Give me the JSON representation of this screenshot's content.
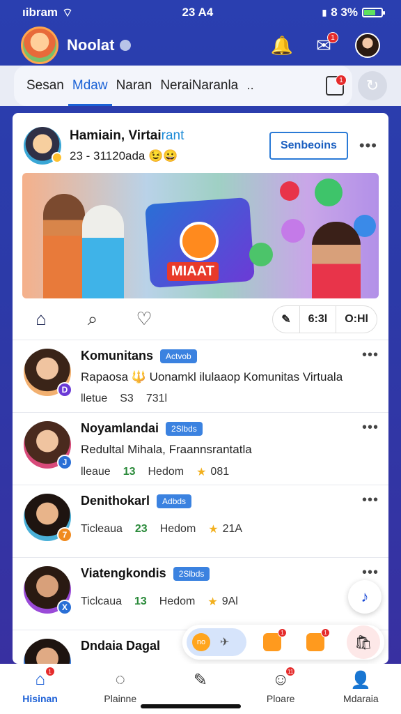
{
  "status_bar": {
    "carrier": "ıibram",
    "time": "23 A4",
    "battery_text": "8 3%",
    "battery_level": 0.6
  },
  "header": {
    "title": "Noolat"
  },
  "tabs": {
    "items": [
      "Sesan",
      "Mdaw",
      "Naran",
      "NeraiNaranla"
    ],
    "active": "Mdaw",
    "more": "..",
    "notif_count": "1"
  },
  "post": {
    "name_bold": "Hamiain, Virtai",
    "name_highlight": "rant",
    "subtitle": "23 - 31120ada 😉😀",
    "subscribe_label": "Senbeoins",
    "banner_text": "MIAAT",
    "pill_left": "6:3l",
    "pill_right": "O:Hl"
  },
  "list": [
    {
      "name": "Komunitans",
      "tag": "Actvob",
      "desc": "Rapaosa 🔱 Uonamkl ilulaaop Komunitas Virtuala",
      "stat1": "lletue",
      "stat2": "S3",
      "stat3": "731l",
      "badge": "D",
      "badge_color": "#6b3ad6"
    },
    {
      "name": "Noyamlandai",
      "tag": "2Slbds",
      "desc": "Redultal Mihala, Fraannsrantatla",
      "stat1": "lleaue",
      "stat2": "13",
      "stat3": "Hedom",
      "stat4": "081",
      "badge": "J",
      "badge_color": "#2a6fd6"
    },
    {
      "name": "Denithokarl",
      "tag": "Adbds",
      "desc": "",
      "stat1": "Ticleaua",
      "stat2": "23",
      "stat3": "Hedom",
      "stat4": "21A",
      "badge": "7",
      "badge_color": "#f08a1e"
    },
    {
      "name": "Viatengkondis",
      "tag": "2Slbds",
      "desc": "",
      "stat1": "Ticlcaua",
      "stat2": "13",
      "stat3": "Hedom",
      "stat4": "9Al",
      "badge": "X",
      "badge_color": "#2a6fd6"
    },
    {
      "name": "Dndaia Dagal",
      "tag": "",
      "desc": "",
      "badge": "",
      "badge_color": "#2a6fd6"
    }
  ],
  "floating": {
    "pill_text": "no",
    "badge1": "1",
    "badge2": "1"
  },
  "bottom_nav": [
    {
      "label": "Hisinan",
      "icon": "home-icon",
      "active": true,
      "badge": "1"
    },
    {
      "label": "Plainne",
      "icon": "chat-icon",
      "active": false,
      "badge": ""
    },
    {
      "label": "",
      "icon": "edit-icon",
      "active": false,
      "badge": ""
    },
    {
      "label": "Ploare",
      "icon": "user-search-icon",
      "active": false,
      "badge": "11"
    },
    {
      "label": "Mdaraia",
      "icon": "profile-icon",
      "active": false,
      "badge": ""
    }
  ],
  "colors": {
    "primary": "#2a3fb0",
    "accent": "#1b62d6",
    "tag": "#3b82e0",
    "notification": "#e52b2b"
  }
}
